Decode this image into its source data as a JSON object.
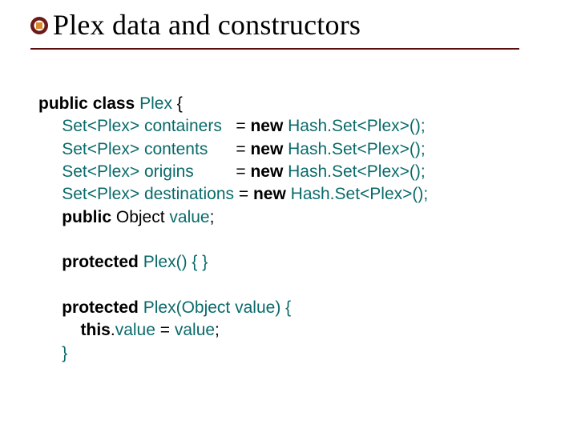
{
  "title": "Plex data and constructors",
  "code": {
    "kw_public": "public",
    "kw_class": "class",
    "kw_new": "new",
    "kw_protected": "protected",
    "kw_this": "this",
    "id_Plex": "Plex",
    "lbrace": " {",
    "type_setplex": "Set<Plex>",
    "field_containers": "containers",
    "field_contents": "contents",
    "field_origins": "origins",
    "field_destinations": "destinations",
    "pad_containers": "   ",
    "pad_contents": "      ",
    "pad_origins": "         ",
    "pad_destinations": " ",
    "eq": "= ",
    "rhs_hashset": "Hash.Set<Plex>();",
    "decl_value_type": " Object ",
    "decl_value_name": "value",
    "semi": ";",
    "ctor0_sig": "() { }",
    "ctor1_sig_open": "(Object ",
    "ctor1_sig_close": ") {",
    "dot": ".",
    "assign_value": " = ",
    "close_brace": "}"
  }
}
